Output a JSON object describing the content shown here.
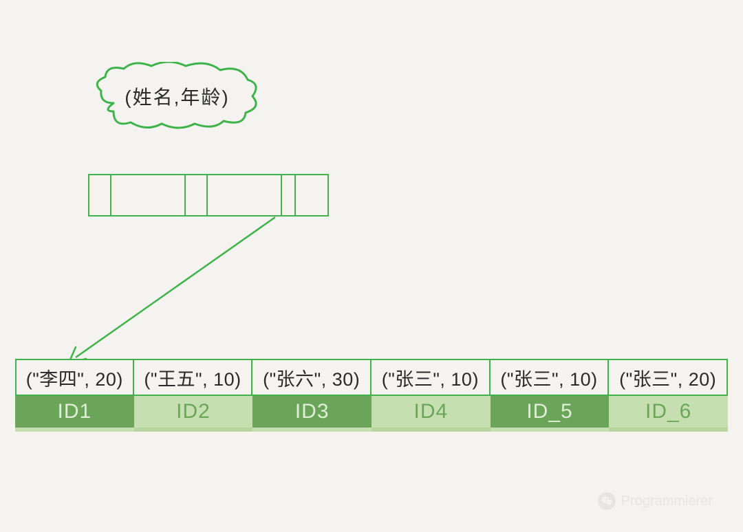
{
  "cloud": {
    "label": "(姓名,年龄)"
  },
  "index_cells": [
    32,
    108,
    32,
    108,
    20,
    50
  ],
  "records": [
    {
      "tuple": "(\"李四\", 20)",
      "id": "ID1",
      "style": "dark"
    },
    {
      "tuple": "(\"王五\", 10)",
      "id": "ID2",
      "style": "light"
    },
    {
      "tuple": "(\"张六\", 30)",
      "id": "ID3",
      "style": "dark"
    },
    {
      "tuple": "(\"张三\", 10)",
      "id": "ID4",
      "style": "light"
    },
    {
      "tuple": "(\"张三\", 10)",
      "id": "ID_5",
      "style": "dark"
    },
    {
      "tuple": "(\"张三\", 20)",
      "id": "ID_6",
      "style": "light"
    }
  ],
  "watermark": {
    "text": "Programmierer"
  }
}
